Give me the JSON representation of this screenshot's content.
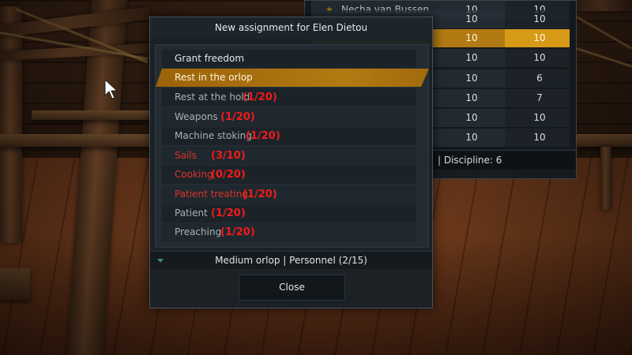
{
  "dialog": {
    "title": "New assignment for Elen Dietou",
    "options": [
      {
        "label": "Grant freedom",
        "count": "",
        "state": "normal",
        "color": "white"
      },
      {
        "label": "Rest in the orlop",
        "count": "",
        "state": "selected",
        "color": "white"
      },
      {
        "label": "Rest at the hold",
        "count": "(1/20)",
        "state": "normal",
        "color": "grey"
      },
      {
        "label": "Weapons",
        "count": "(1/20)",
        "state": "normal",
        "color": "grey"
      },
      {
        "label": "Machine stoking",
        "count": "(1/20)",
        "state": "normal",
        "color": "grey"
      },
      {
        "label": "Sails",
        "count": "(3/10)",
        "state": "disabled",
        "color": "red"
      },
      {
        "label": "Cooking",
        "count": "(0/20)",
        "state": "disabled",
        "color": "red"
      },
      {
        "label": "Patient treating",
        "count": "(1/20)",
        "state": "disabled",
        "color": "red"
      },
      {
        "label": "Patient",
        "count": "(1/20)",
        "state": "normal",
        "color": "grey"
      },
      {
        "label": "Preaching",
        "count": "(1/20)",
        "state": "normal",
        "color": "grey"
      }
    ],
    "status": "Medium orlop | Personnel (2/15)",
    "close_label": "Close"
  },
  "crew_table": {
    "rows": [
      {
        "name": "Necha van Bussen",
        "v1": "10",
        "v2": "10",
        "highlight": false
      },
      {
        "name": "",
        "v1": "10",
        "v2": "10",
        "highlight": false
      },
      {
        "name": "",
        "v1": "10",
        "v2": "10",
        "highlight": true
      },
      {
        "name": "",
        "v1": "10",
        "v2": "10",
        "highlight": false
      },
      {
        "name": "",
        "v1": "10",
        "v2": "6",
        "highlight": false
      },
      {
        "name": "",
        "v1": "10",
        "v2": "7",
        "highlight": false
      },
      {
        "name": "",
        "v1": "10",
        "v2": "10",
        "highlight": false
      },
      {
        "name": "",
        "v1": "10",
        "v2": "10",
        "highlight": false
      }
    ],
    "footer": "|  Discipline: 6"
  },
  "colors": {
    "accent": "#b27a12",
    "warning_red": "#f11b1b",
    "panel_bg": "#1a2126"
  },
  "icons": {
    "cursor": "mouse-pointer-icon",
    "status_expand": "triangle-down-icon"
  }
}
